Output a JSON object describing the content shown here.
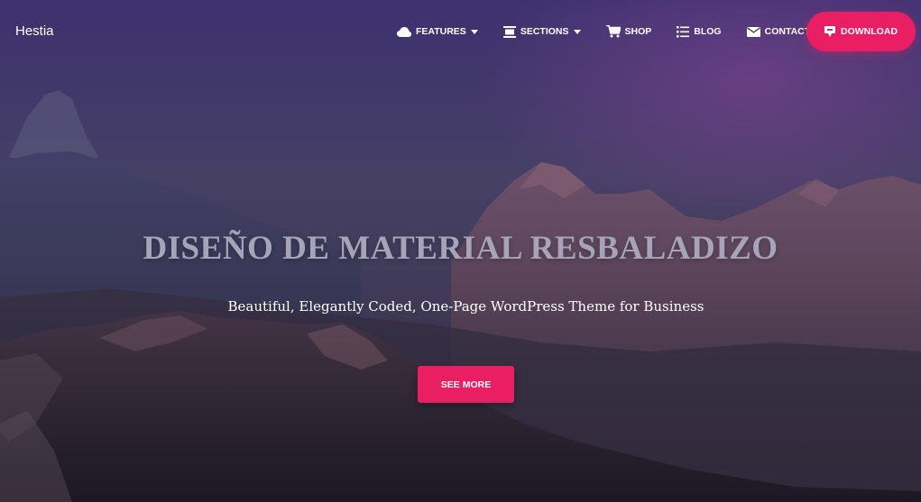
{
  "brand": {
    "name": "Hestia"
  },
  "nav": {
    "items": [
      {
        "label": "FEATURES",
        "icon": "cloud-icon",
        "has_dropdown": true
      },
      {
        "label": "SECTIONS",
        "icon": "sections-icon",
        "has_dropdown": true
      },
      {
        "label": "SHOP",
        "icon": "cart-icon",
        "has_dropdown": false
      },
      {
        "label": "BLOG",
        "icon": "list-icon",
        "has_dropdown": false
      },
      {
        "label": "CONTACT",
        "icon": "envelope-icon",
        "has_dropdown": false
      }
    ],
    "download_label": "DOWNLOAD",
    "download_icon": "download-icon"
  },
  "hero": {
    "title": "DISEÑO DE MATERIAL RESBALADIZO",
    "subtitle": "Beautiful, Elegantly Coded, One-Page WordPress Theme for Business",
    "cta_label": "SEE MORE"
  },
  "colors": {
    "accent": "#e91e63",
    "title": "#a7a3b8",
    "text": "#ffffff"
  }
}
